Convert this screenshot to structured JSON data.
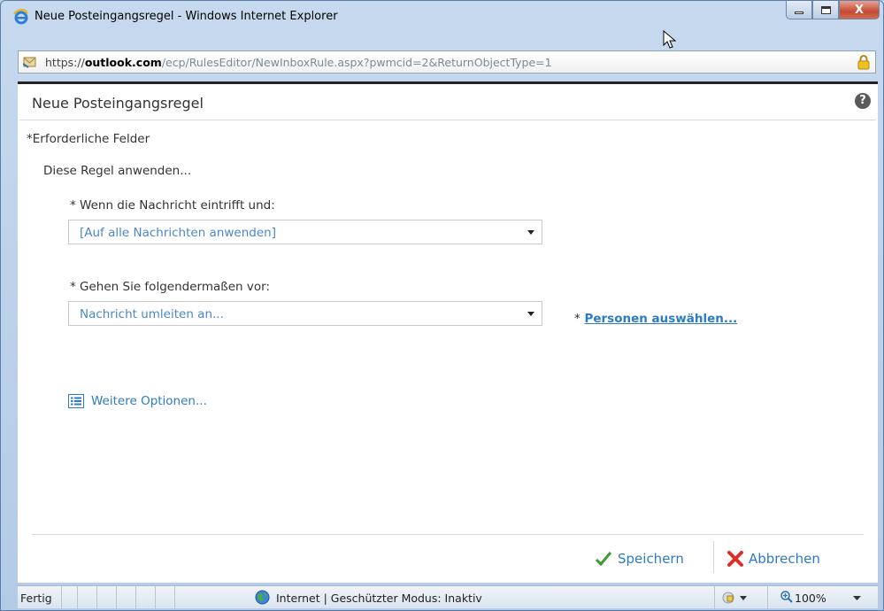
{
  "window": {
    "title": "Neue Posteingangsregel - Windows Internet Explorer",
    "minimize_label": "minimize",
    "maximize_label": "maximize",
    "close_label": "X"
  },
  "address_bar": {
    "protocol": "https://",
    "domain": "outlook.com",
    "path": "/ecp/RulesEditor/NewInboxRule.aspx?pwmcid=2&ReturnObjectType=1"
  },
  "dialog": {
    "title": "Neue Posteingangsregel",
    "help_glyph": "?",
    "required_fields_note": "*Erforderliche Felder",
    "apply_rule_label": "Diese Regel anwenden...",
    "condition": {
      "label": "* Wenn die Nachricht eintrifft und:",
      "selected": "[Auf alle Nachrichten anwenden]"
    },
    "action": {
      "label": "* Gehen Sie folgendermaßen vor:",
      "selected": "Nachricht umleiten an..."
    },
    "people_picker": {
      "star": "*",
      "label": "Personen auswählen..."
    },
    "more_options_label": "Weitere Optionen...",
    "save_label": "Speichern",
    "cancel_label": "Abbrechen"
  },
  "status_bar": {
    "state": "Fertig",
    "zone": "Internet | Geschützter Modus: Inaktiv",
    "zoom": "100%"
  },
  "colors": {
    "link_blue": "#2e7bc4",
    "save_green": "#3c9a2e",
    "cancel_red": "#d9302a"
  }
}
